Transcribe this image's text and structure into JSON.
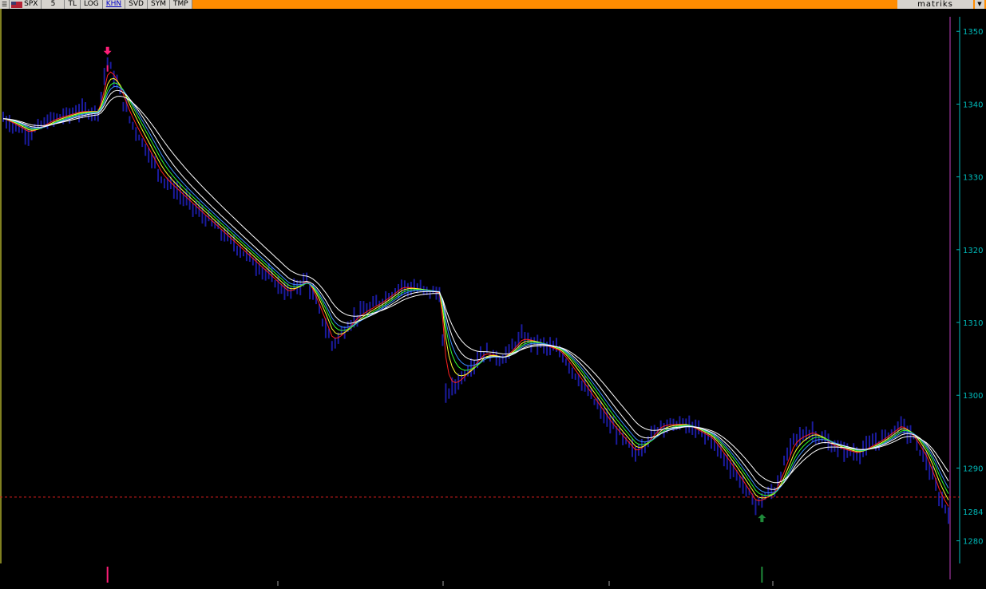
{
  "toolbar": {
    "menu_icon": "menu-icon",
    "flag_icon": "us-flag-icon",
    "symbol": "SPX",
    "period": "5",
    "buttons": [
      "TL",
      "LOG",
      "KHN",
      "SVD",
      "SYM",
      "TMP"
    ],
    "active_button": "KHN",
    "brand": "matriks",
    "dropdown_icon": "chevron-down-icon"
  },
  "colors": {
    "background": "#000000",
    "price_bars": "#1b1b9e",
    "axis": "#00bcbc",
    "reference_line": "#e02020",
    "sell_signal": "#ff1e78",
    "buy_signal": "#1f8a3a",
    "toolbar": "#ff8c00",
    "ma": [
      "#ff2020",
      "#ffff30",
      "#30ff30",
      "#3c8cff",
      "#ffffff",
      "#ffffff"
    ]
  },
  "chart_data": {
    "type": "line",
    "symbol": "SPX",
    "ylim": [
      1277,
      1352
    ],
    "y_ticks": [
      1350,
      1340,
      1330,
      1320,
      1310,
      1300,
      1290,
      1280
    ],
    "current_price_label": "1284",
    "reference_level": 1286,
    "x_count": 300,
    "price_keypoints": [
      [
        0,
        1338
      ],
      [
        8,
        1336
      ],
      [
        16,
        1338
      ],
      [
        24,
        1339
      ],
      [
        30,
        1339
      ],
      [
        33,
        1346
      ],
      [
        40,
        1338
      ],
      [
        50,
        1330
      ],
      [
        60,
        1326
      ],
      [
        70,
        1322
      ],
      [
        80,
        1318
      ],
      [
        90,
        1314
      ],
      [
        96,
        1316
      ],
      [
        104,
        1307
      ],
      [
        112,
        1311
      ],
      [
        120,
        1313
      ],
      [
        126,
        1315
      ],
      [
        138,
        1314
      ],
      [
        140,
        1300
      ],
      [
        146,
        1303
      ],
      [
        152,
        1306
      ],
      [
        158,
        1305
      ],
      [
        164,
        1308
      ],
      [
        170,
        1307
      ],
      [
        176,
        1306
      ],
      [
        184,
        1301
      ],
      [
        192,
        1296
      ],
      [
        200,
        1292
      ],
      [
        208,
        1296
      ],
      [
        216,
        1296
      ],
      [
        224,
        1294
      ],
      [
        232,
        1289
      ],
      [
        238,
        1285
      ],
      [
        244,
        1287
      ],
      [
        250,
        1294
      ],
      [
        256,
        1295
      ],
      [
        262,
        1293
      ],
      [
        270,
        1292
      ],
      [
        278,
        1294
      ],
      [
        284,
        1296
      ],
      [
        288,
        1294
      ],
      [
        292,
        1291
      ],
      [
        296,
        1286
      ],
      [
        299,
        1284
      ]
    ],
    "moving_average_periods": [
      3,
      5,
      7,
      9,
      12,
      18
    ],
    "signals": [
      {
        "type": "sell",
        "x": 33,
        "price": 1346
      },
      {
        "type": "buy",
        "x": 240,
        "price": 1284
      }
    ],
    "grid": false
  }
}
